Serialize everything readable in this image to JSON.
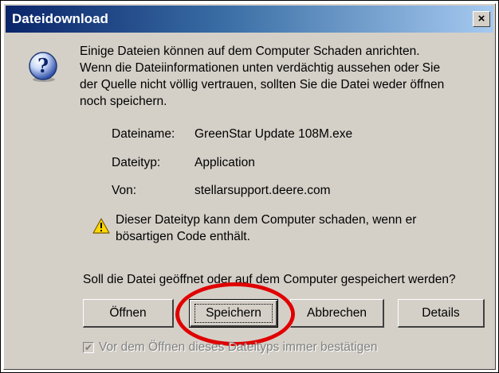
{
  "window": {
    "title": "Dateidownload",
    "close_label": "×"
  },
  "message": {
    "lines": [
      "Einige Dateien können auf dem Computer Schaden anrichten.",
      "Wenn die Dateiinformationen unten verdächtig aussehen oder Sie",
      "der Quelle nicht völlig vertrauen, sollten Sie die Datei weder öffnen",
      "noch speichern."
    ]
  },
  "file_info": {
    "name_label": "Dateiname:",
    "name_value": "GreenStar Update 108M.exe",
    "type_label": "Dateityp:",
    "type_value": "Application",
    "from_label": "Von:",
    "from_value": "stellarsupport.deere.com"
  },
  "warning": {
    "icon": "warning-icon",
    "lines": [
      "Dieser Dateityp kann dem Computer schaden, wenn er",
      "bösartigen Code enthält."
    ]
  },
  "question": "Soll die Datei geöffnet oder auf dem Computer gespeichert werden?",
  "buttons": {
    "open": "Öffnen",
    "save": "Speichern",
    "cancel": "Abbrechen",
    "details": "Details"
  },
  "checkbox": {
    "label": "Vor dem Öffnen dieses Dateityps immer bestätigen",
    "checked": true,
    "enabled": false
  },
  "colors": {
    "title_bar_start": "#0a246a",
    "title_bar_end": "#a6caf0",
    "dialog_face": "#d4d0c8",
    "annotation_red": "#e00000"
  }
}
